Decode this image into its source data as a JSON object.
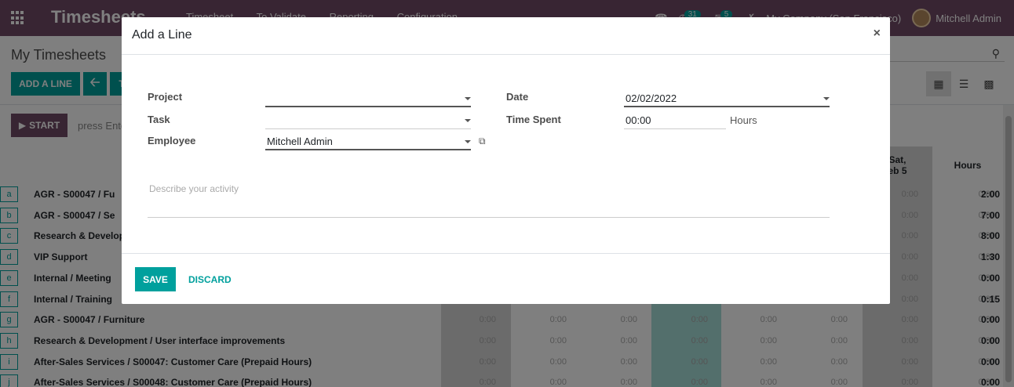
{
  "navbar": {
    "brand": "Timesheets",
    "menu": [
      "Timesheet",
      "To Validate",
      "Reporting",
      "Configuration"
    ],
    "activity_count": "31",
    "message_count": "5",
    "company": "My Company (San Francisco)",
    "user": "Mitchell Admin"
  },
  "control": {
    "page_title": "My Timesheets",
    "add_line_label": "ADD A LINE",
    "today_label": "T",
    "start_label": "START",
    "start_hint": "press Ente"
  },
  "grid": {
    "headers": {
      "sat": "Sat,\neb 5",
      "hours": "Hours"
    },
    "rows": [
      {
        "key": "a",
        "label": "AGR - S00047  /  Fu",
        "total": "2:00"
      },
      {
        "key": "b",
        "label": "AGR - S00047  /  Se",
        "total": "7:00"
      },
      {
        "key": "c",
        "label": "Research & Develop",
        "total": "8:00"
      },
      {
        "key": "d",
        "label": "VIP Support",
        "total": "1:30"
      },
      {
        "key": "e",
        "label": "Internal  /  Meeting",
        "total": "0:00"
      },
      {
        "key": "f",
        "label": "Internal  /  Training",
        "total": "0:15"
      },
      {
        "key": "g",
        "label": "AGR - S00047  /  Furniture",
        "total": "0:00"
      },
      {
        "key": "h",
        "label": "Research & Development  /  User interface improvements",
        "total": "0:00"
      },
      {
        "key": "i",
        "label": "After-Sales Services  /  S00047: Customer Care (Prepaid Hours)",
        "total": "0:00"
      },
      {
        "key": "j",
        "label": "After-Sales Services  /  S00048: Customer Care (Prepaid Hours)",
        "total": "0:00"
      }
    ],
    "cell_value": "0:00"
  },
  "modal": {
    "title": "Add a Line",
    "close": "×",
    "project_label": "Project",
    "project_value": "",
    "task_label": "Task",
    "task_value": "",
    "employee_label": "Employee",
    "employee_value": "Mitchell Admin",
    "date_label": "Date",
    "date_value": "02/02/2022",
    "time_label": "Time Spent",
    "time_value": "00:00",
    "time_unit": "Hours",
    "description_placeholder": "Describe your activity",
    "save_label": "SAVE",
    "discard_label": "DISCARD"
  },
  "colors": {
    "brand": "#714B67",
    "accent": "#00A09D"
  }
}
